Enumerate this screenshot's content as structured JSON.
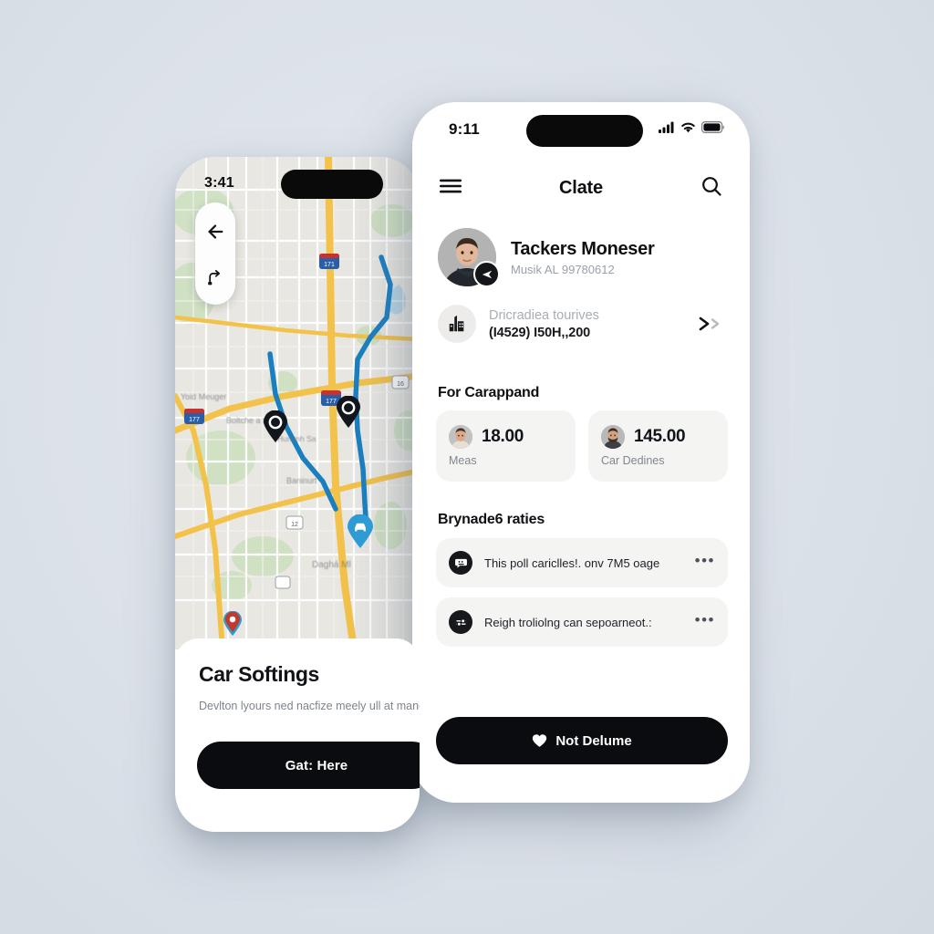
{
  "background_color": "#dde3e9",
  "left_phone": {
    "status": {
      "time": "3:41"
    },
    "map": {
      "controls": [
        {
          "name": "back-arrow-icon",
          "label": "Back"
        },
        {
          "name": "route-share-icon",
          "label": "Route"
        }
      ],
      "pins": [
        {
          "type": "stop-pin",
          "color": "#12161c"
        },
        {
          "type": "stop-pin",
          "color": "#12161c"
        },
        {
          "type": "car-pin",
          "color": "#2e9bd4"
        },
        {
          "type": "place-pin",
          "color": "#c0392b"
        }
      ],
      "labels": [
        "Yoid Meuger",
        "Boltche a ttror",
        "Hummh Sa",
        "Baninurt",
        "Daghá Ml"
      ],
      "route_color": "#1a7fc1",
      "highway_color": "#f5c243"
    },
    "sheet": {
      "title": "Car Softings",
      "body": "Devlton lyours ned nacfize meely ull at manch mant or your cantioing to dudcite",
      "cta_label": "Gat: Here"
    }
  },
  "right_phone": {
    "status": {
      "time": "9:11",
      "icons": [
        "signal-icon",
        "wifi-icon",
        "battery-icon"
      ]
    },
    "navbar": {
      "menu_icon": "hamburger-icon",
      "title": "Clate",
      "search_icon": "search-icon"
    },
    "profile": {
      "name": "Tackers Moneser",
      "subtitle": "Musik AL 99780612",
      "badge_icon": "send-icon"
    },
    "destination": {
      "icon": "building-icon",
      "label": "Dricradiea tourives",
      "value": "(I4529) I50H,,200",
      "arrow_icon": "double-chevron-right-icon"
    },
    "stats": {
      "heading": "For Carappand",
      "cards": [
        {
          "value": "18.00",
          "label": "Meas"
        },
        {
          "value": "145.00",
          "label": "Car Dedines"
        }
      ]
    },
    "list": {
      "heading": "Brynade6 raties",
      "rows": [
        {
          "icon": "chat-bubble-icon",
          "text": "This poll cariclles!. onv 7M5 oage",
          "more_icon": "more-icon",
          "more_label": "•••"
        },
        {
          "icon": "sliders-icon",
          "text": "Reigh troliolng can sepoarneot.:",
          "more_icon": "more-icon",
          "more_label": "•••"
        }
      ]
    },
    "cta": {
      "icon": "heart-icon",
      "label": "Not Delume"
    }
  }
}
